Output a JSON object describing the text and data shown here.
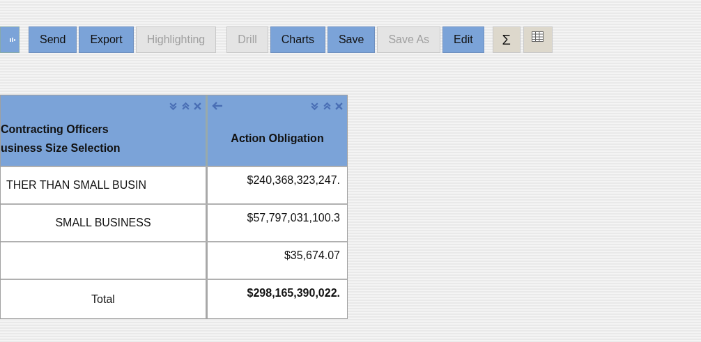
{
  "toolbar": {
    "buttons": [
      {
        "label": "Send",
        "disabled": false
      },
      {
        "label": "Export",
        "disabled": false
      },
      {
        "label": "Highlighting",
        "disabled": true
      },
      {
        "label": "Drill",
        "disabled": true
      },
      {
        "label": "Charts",
        "disabled": false
      },
      {
        "label": "Save",
        "disabled": false
      },
      {
        "label": "Save As",
        "disabled": true
      },
      {
        "label": "Edit",
        "disabled": false
      }
    ],
    "toggles": [
      {
        "kind": "sum",
        "label": "Σ"
      },
      {
        "kind": "grid"
      }
    ]
  },
  "table": {
    "columns": [
      {
        "label_lines": [
          "Contracting Officers",
          "usiness Size Selection"
        ],
        "back_arrow": false
      },
      {
        "label_lines": [
          "Action Obligation"
        ],
        "back_arrow": true
      }
    ],
    "rows": [
      {
        "cells": [
          "THER THAN SMALL BUSIN",
          "$240,368,323,247."
        ],
        "total": false
      },
      {
        "cells": [
          "SMALL BUSINESS",
          "$57,797,031,100.3"
        ],
        "total": false
      },
      {
        "cells": [
          "",
          "$35,674.07"
        ],
        "total": false
      },
      {
        "cells": [
          "Total",
          "$298,165,390,022."
        ],
        "total": true
      }
    ]
  }
}
